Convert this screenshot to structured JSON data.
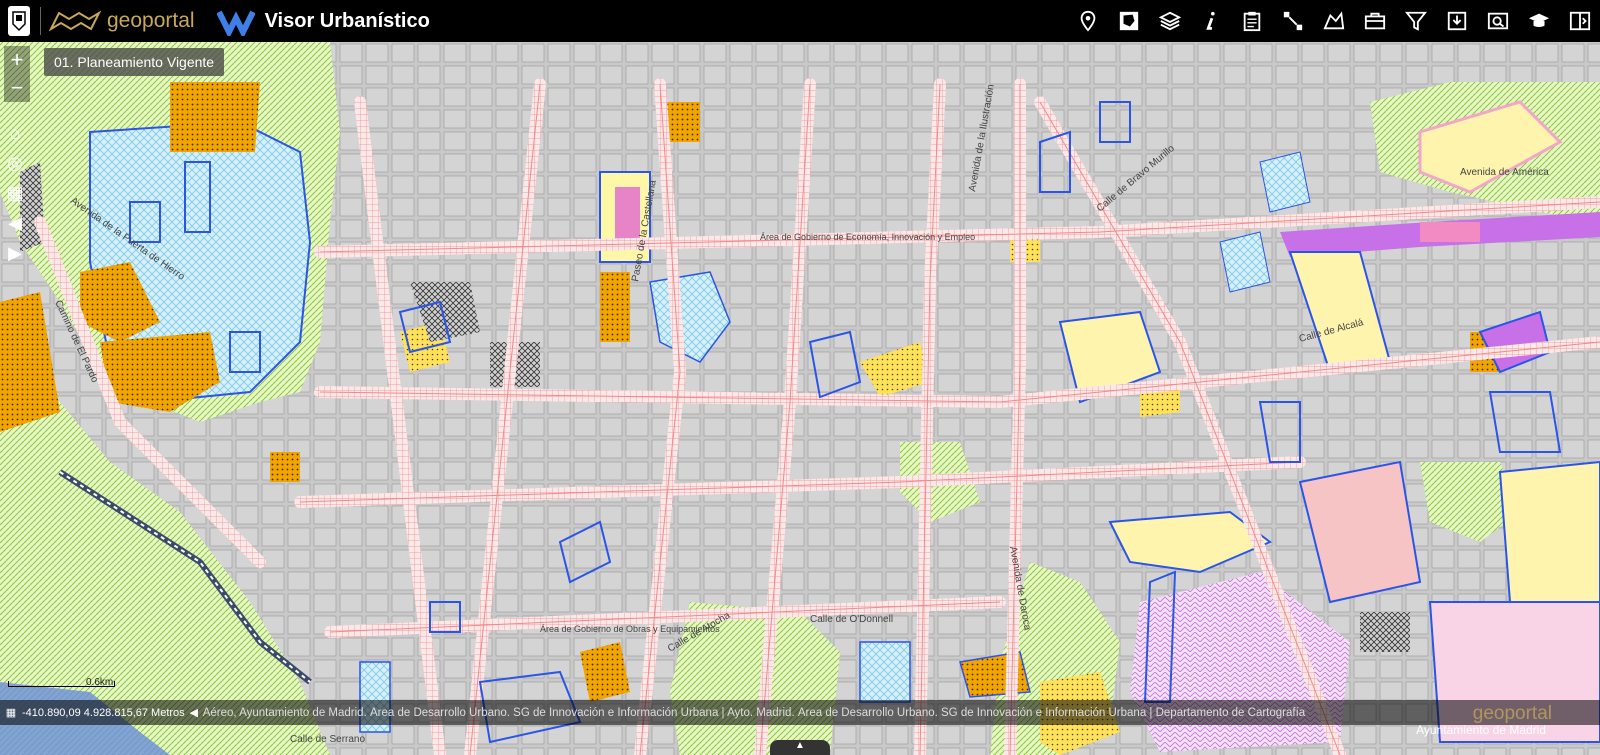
{
  "header": {
    "brand1": "geoportal",
    "brand2": "Visor Urbanístico"
  },
  "toolbar": {
    "tools": [
      "location-pin-icon",
      "map-district-icon",
      "layers-icon",
      "info-icon",
      "clipboard-icon",
      "measure-icon",
      "map-catalog-icon",
      "briefcase-icon",
      "filter-icon",
      "download-icon",
      "search-icon",
      "graduation-icon",
      "split-view-icon"
    ]
  },
  "layer_label": "01. Planeamiento Vigente",
  "map_labels": [
    "Avenida de la Puerta de Hierro",
    "Camino de El Pardo",
    "Paseo de la Castellana",
    "Área de Gobierno de Economía, Innovación y Empleo",
    "Avenida de la Ilustración",
    "Avenida de América",
    "Calle de Alcalá",
    "Avenida de Daroca",
    "Área de Gobierno de Obras y Equipamientos",
    "Calle de Bravo Murillo",
    "Calle de O'Donnell",
    "Calle de Atocha",
    "Calle de Serrano"
  ],
  "scale": {
    "label": "0.6km"
  },
  "footer": {
    "coordinates": "-410.890,09 4.928.815,67 Metros",
    "attribution": "Aéreo, Ayuntamiento de Madrid. Área de Desarrollo Urbano. SG de Innovación e Información Urbana | Ayto. Madrid. Área de Desarrollo Urbano. SG de Innovación e Información Urbana | Departamento de Cartografía"
  },
  "brand_footer": {
    "geoportal": "geoportal",
    "city": "Ayuntamiento de Madrid"
  },
  "colors": {
    "topbar": "#000000",
    "urban": "#cfcfcf",
    "green": "#b8e05c",
    "orange": "#f0a500",
    "yellow": "#ffe97a",
    "blue_outline": "#2a55e8",
    "cyan": "#c7eaf5",
    "pink": "#f2a6c8",
    "purple": "#c770e8",
    "road": "#f5b0b0"
  }
}
